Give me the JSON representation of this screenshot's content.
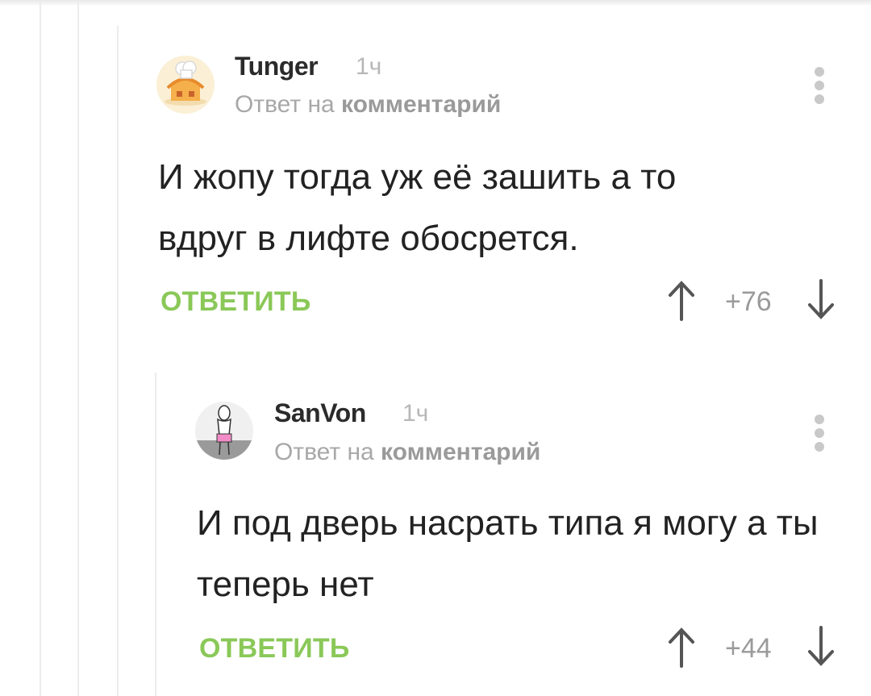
{
  "comments": [
    {
      "author": "Tunger",
      "time": "1ч",
      "reply_prefix": "Ответ на",
      "reply_target": "комментарий",
      "text": "И жопу тогда уж её зашить а то вдруг в лифте обосрется.",
      "reply_label": "ОТВЕТИТЬ",
      "score": "+76",
      "avatar_icon": "cook-house-avatar"
    },
    {
      "author": "SanVon",
      "time": "1ч",
      "reply_prefix": "Ответ на",
      "reply_target": "комментарий",
      "text": "И под дверь насрать типа я могу а ты теперь нет",
      "reply_label": "ОТВЕТИТЬ",
      "score": "+44",
      "avatar_icon": "stickman-avatar"
    }
  ],
  "colors": {
    "accent_green": "#8ac858",
    "muted": "#a8a8a8",
    "thread_line": "#ececec"
  }
}
